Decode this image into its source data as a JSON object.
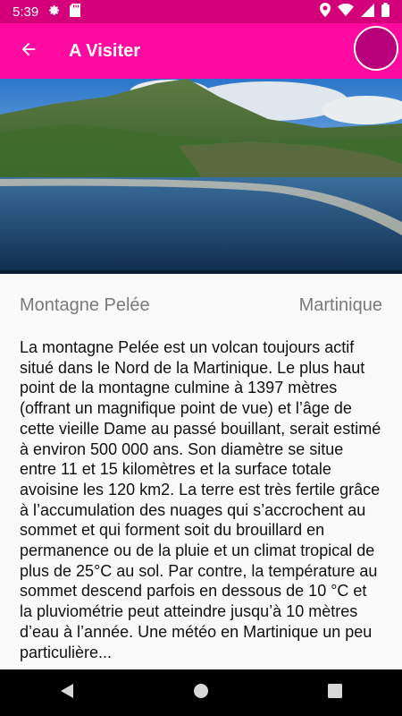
{
  "status_bar": {
    "time": "5:39",
    "left_icons": [
      "gear-icon",
      "sd-card-icon"
    ],
    "right_icons": [
      "location-icon",
      "wifi-icon",
      "signal-icon",
      "battery-icon"
    ]
  },
  "app_bar": {
    "title": "A Visiter",
    "back_icon": "arrow-left-icon",
    "color": "#ff0aa0"
  },
  "place": {
    "name": "Montagne Pelée",
    "region": "Martinique",
    "description": "La montagne Pelée est un volcan toujours actif situé dans le Nord de la Martinique. Le plus haut point de la montagne culmine à 1397 mètres (offrant un magnifique point de vue) et l’âge de cette vieille Dame au passé bouillant, serait estimé à environ 500 000 ans. Son diamètre se situe entre 11 et 15 kilomètres et la surface totale avoisine les 120 km2. La terre est très fertile grâce à l’accumulation des nuages qui s’accrochent au sommet et qui forment soit du brouillard en permanence ou de la pluie et un climat tropical de plus de 25°C au sol. Par contre, la température au sommet descend parfois en dessous de 10 °C et la pluviométrie peut atteindre jusqu’à 10 mètres d’eau à l’année. Une météo en Martinique un peu particulière..."
  },
  "nav_bar": {
    "icons": [
      "back-triangle-icon",
      "home-circle-icon",
      "recents-square-icon"
    ]
  }
}
